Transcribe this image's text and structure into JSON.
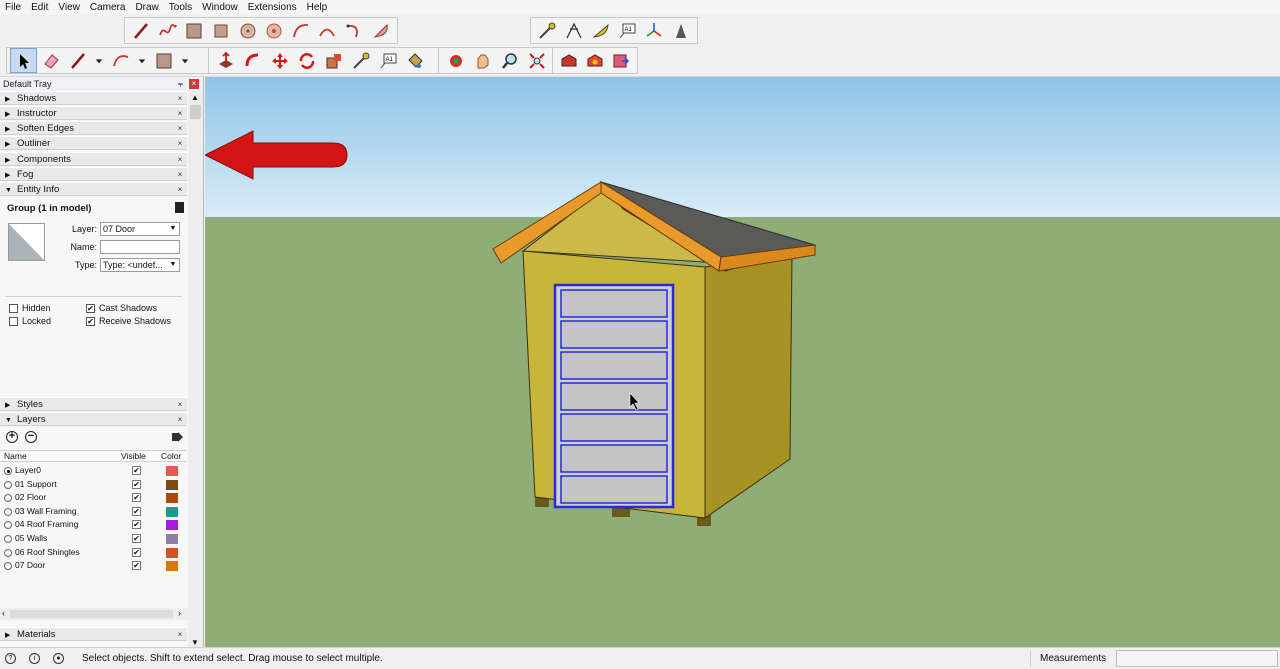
{
  "menu": [
    "File",
    "Edit",
    "View",
    "Camera",
    "Draw",
    "Tools",
    "Window",
    "Extensions",
    "Help"
  ],
  "toolbar_row1": {
    "draw_tools": [
      "line-icon",
      "freehand-icon",
      "rectangle-icon",
      "rotated-rectangle-icon",
      "circle-icon",
      "polygon-icon",
      "arc-icon",
      "two-point-arc-icon",
      "three-point-arc-icon",
      "pie-icon"
    ],
    "construction_tools": [
      "tape-measure-icon",
      "dimension-icon",
      "protractor-icon",
      "text-icon",
      "axes-icon",
      "3d-text-icon"
    ]
  },
  "toolbar_row2": [
    "select-icon",
    "eraser-icon",
    "line-icon",
    "arc-icon",
    "rectangle-icon",
    "push-pull-icon",
    "follow-me-icon",
    "move-icon",
    "rotate-icon",
    "scale-icon",
    "tape-measure-icon",
    "text-icon",
    "paint-bucket-icon",
    "orbit-icon",
    "pan-icon",
    "zoom-icon",
    "zoom-extents-icon",
    "warehouse-icon",
    "extension-warehouse-icon",
    "send-to-layout-icon"
  ],
  "tray": {
    "title": "Default Tray",
    "panels_top": [
      "Shadows",
      "Instructor",
      "Soften Edges",
      "Outliner",
      "Components",
      "Fog",
      "Entity Info"
    ],
    "panels_bottom": [
      "Styles",
      "Layers"
    ],
    "panel_last": "Materials",
    "close_glyph": "×",
    "collapsed_glyph": "▶",
    "expanded_glyph": "▼"
  },
  "entity_info": {
    "title": "Group (1 in model)",
    "layer_label": "Layer:",
    "layer_value": "07 Door",
    "name_label": "Name:",
    "name_value": "",
    "type_label": "Type:",
    "type_value": "Type: <undef...",
    "hidden_label": "Hidden",
    "locked_label": "Locked",
    "cast_shadows_label": "Cast Shadows",
    "receive_shadows_label": "Receive Shadows",
    "hidden": false,
    "locked": false,
    "cast_shadows": true,
    "receive_shadows": true
  },
  "layers": {
    "headers": {
      "name": "Name",
      "visible": "Visible",
      "color": "Color"
    },
    "add_glyph": "+",
    "remove_glyph": "−",
    "rows": [
      {
        "name": "Layer0",
        "active": true,
        "visible": true,
        "color": "#e9574f"
      },
      {
        "name": "01 Support",
        "active": false,
        "visible": true,
        "color": "#7a4a12"
      },
      {
        "name": "02 Floor",
        "active": false,
        "visible": true,
        "color": "#b04a0c"
      },
      {
        "name": "03 Wall Framing",
        "active": false,
        "visible": true,
        "color": "#1b9a8e"
      },
      {
        "name": "04 Roof Framing",
        "active": false,
        "visible": true,
        "color": "#a21de0"
      },
      {
        "name": "05 Walls",
        "active": false,
        "visible": true,
        "color": "#8a7fa2"
      },
      {
        "name": "06 Roof Shingles",
        "active": false,
        "visible": true,
        "color": "#c9561f"
      },
      {
        "name": "07 Door",
        "active": false,
        "visible": true,
        "color": "#d8780a"
      }
    ]
  },
  "status": {
    "message": "Select objects. Shift to extend select. Drag mouse to select multiple.",
    "measurements_label": "Measurements",
    "measurements_value": ""
  },
  "colors": {
    "sky_top": "#8ec4e8",
    "ground": "#8fad77",
    "selection": "#2a2ad8",
    "arrow": "#d21414"
  }
}
